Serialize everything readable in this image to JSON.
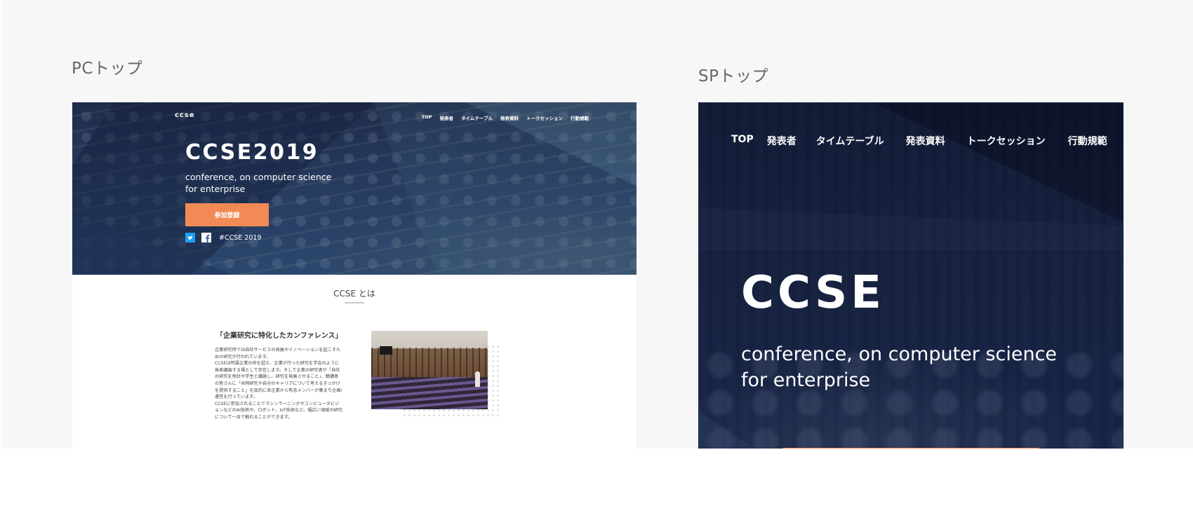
{
  "sections": {
    "pc_title": "PCトップ",
    "sp_title": "SPトップ"
  },
  "pc": {
    "logo": "ccse",
    "nav": [
      "TOP",
      "発表者",
      "タイムテーブル",
      "発表資料",
      "トークセッション",
      "行動規範"
    ],
    "hero_title": "CCSE2019",
    "subtitle_line1": "conference, on computer science",
    "subtitle_line2": "for enterprise",
    "cta_label": "参加登録",
    "hashtag": "#CCSE 2019",
    "about_heading": "CCSE とは",
    "quote": "「企業研究に特化したカンファレンス」",
    "body": [
      "企業研究所では自社サービスの発展やイノベーションを起こすための研究が行われています。",
      "CCSEは所属企業の枠を超え、企業が行った研究を学会のように発表議論する場として存在します。そして企業の研究者が「自社の研究を他社や学生と議論し、研究を発展させること」、聴講者の皆さんに「共同研究や自分のキャリアについて考えるきっかけを提供すること」を目的に各企業から有志メンバーが集まり企画/運営を行っています。",
      "CCSEに参加されることでマシンラーニングやコンピュータビジョンなどのAI技術や、ロボット、IoT技術など、幅広い領域の研究について一日で触れることができます。"
    ]
  },
  "sp": {
    "nav": [
      "TOP",
      "発表者",
      "タイムテーブル",
      "発表資料",
      "トークセッション",
      "行動規範"
    ],
    "hero_title": "CCSE",
    "subtitle_line1": "conference, on computer science",
    "subtitle_line2": "for enterprise"
  },
  "colors": {
    "accent": "#f28a57",
    "hero_navy": "#1f2c4a",
    "sp_navy": "#121b36",
    "background": "#f7f7f7"
  },
  "icons": [
    "twitter-icon",
    "facebook-icon"
  ]
}
